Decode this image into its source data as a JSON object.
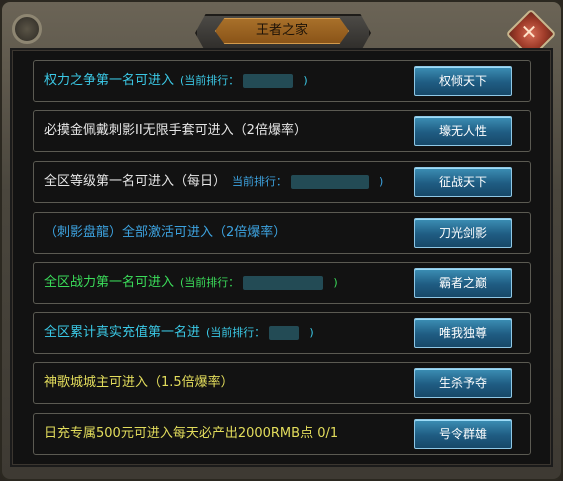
{
  "window": {
    "title": "王者之家",
    "close_glyph": "✕"
  },
  "colors": {
    "cyan": "#3bc9e6",
    "white": "#e6e6e6",
    "blue": "#3da3e0",
    "green": "#3bdc5a",
    "yellow": "#e3dd5c",
    "button_top": "#3c8fb5",
    "button_bottom": "#174868"
  },
  "rows": [
    {
      "text": "权力之争第一名可进入",
      "rank_label": "(当前排行：",
      "rank_end": ")",
      "button": "权倾天下"
    },
    {
      "text": "必摸金佩戴刺影II无限手套可进入（2倍爆率）",
      "button": "壕无人性"
    },
    {
      "text": "全区等级第一名可进入（每日）",
      "rank_label": "当前排行：",
      "rank_end": ")",
      "button": "征战天下"
    },
    {
      "text": "（刺影盘龍）全部激活可进入（2倍爆率）",
      "button": "刀光剑影"
    },
    {
      "text": "全区战力第一名可进入",
      "rank_label": "(当前排行：",
      "rank_end": ")",
      "button": "霸者之巅"
    },
    {
      "text": "全区累计真实充值第一名进",
      "rank_label": "(当前排行：",
      "rank_end": ")",
      "button": "唯我独尊"
    },
    {
      "text": "神歌城城主可进入（1.5倍爆率）",
      "button": "生杀予夺"
    },
    {
      "text": "日充专属500元可进入每天必产出2000RMB点 0/1",
      "button": "号令群雄"
    }
  ]
}
